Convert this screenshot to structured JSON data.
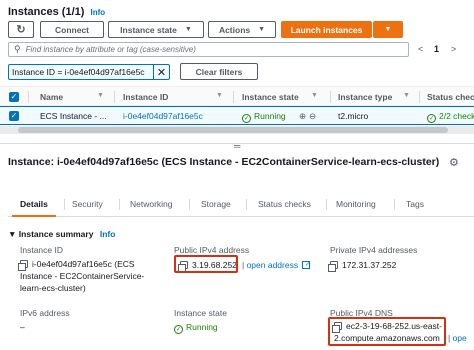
{
  "header": {
    "title": "Instances (1/1)",
    "info_link": "Info"
  },
  "toolbar": {
    "refresh_icon": "refresh-icon",
    "connect_label": "Connect",
    "instance_state_label": "Instance state",
    "actions_label": "Actions",
    "launch_label": "Launch instances"
  },
  "search": {
    "placeholder": "Find instance by attribute or tag (case-sensitive)"
  },
  "pagination": {
    "prev": "<",
    "page": "1",
    "next": ">"
  },
  "filter": {
    "token_text": "Instance ID = i-0e4ef04d97af16e5c",
    "clear_label": "Clear filters"
  },
  "table": {
    "columns": [
      "Name",
      "Instance ID",
      "Instance state",
      "Instance type",
      "Status check"
    ],
    "row": {
      "name": "ECS Instance - ...",
      "instance_id": "i-0e4ef04d97af16e5c",
      "state": "Running",
      "type": "t2.micro",
      "status": "2/2 check"
    }
  },
  "details": {
    "title": "Instance: i-0e4ef04d97af16e5c (ECS Instance - EC2ContainerService-learn-ecs-cluster)",
    "tabs": [
      "Details",
      "Security",
      "Networking",
      "Storage",
      "Status checks",
      "Monitoring",
      "Tags"
    ],
    "active_tab": "Details",
    "summary_label": "Instance summary",
    "summary_info": "Info",
    "fields": {
      "instance_id_label": "Instance ID",
      "instance_id_value": "i-0e4ef04d97af16e5c (ECS Instance - EC2ContainerService-learn-ecs-cluster)",
      "public_ipv4_label": "Public IPv4 address",
      "public_ipv4_value": "3.19.68.252",
      "open_address": "open address",
      "private_ipv4_label": "Private IPv4 addresses",
      "private_ipv4_value": "172.31.37.252",
      "ipv6_label": "IPv6 address",
      "ipv6_value": "–",
      "instance_state_label": "Instance state",
      "instance_state_value": "Running",
      "public_dns_label": "Public IPv4 DNS",
      "public_dns_value": "ec2-3-19-68-252.us-east-2.compute.amazonaws.com",
      "open_link": "ope"
    }
  },
  "colors": {
    "primary": "#ec7211",
    "link": "#0073bb",
    "success": "#1d8102",
    "highlight": "#d13212"
  }
}
